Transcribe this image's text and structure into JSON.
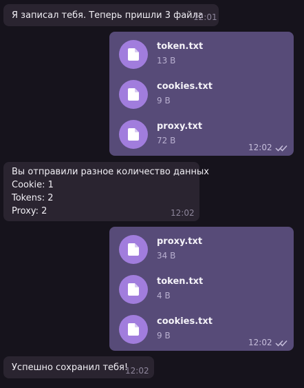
{
  "messages": {
    "m1": {
      "text": "Я записал тебя. Теперь пришли 3 файла",
      "time": "12:01"
    },
    "m2": {
      "files": [
        {
          "name": "token.txt",
          "size": "13 B",
          "icon": "file-icon"
        },
        {
          "name": "cookies.txt",
          "size": "9 B",
          "icon": "file-icon"
        },
        {
          "name": "proxy.txt",
          "size": "72 B",
          "icon": "file-icon"
        }
      ],
      "time": "12:02",
      "status_icon": "double-check-icon"
    },
    "m3": {
      "lines": [
        "Вы отправили разное количество данных",
        "Cookie: 1",
        "Tokens: 2",
        "Proxy: 2"
      ],
      "time": "12:02"
    },
    "m4": {
      "files": [
        {
          "name": "proxy.txt",
          "size": "34 B",
          "icon": "file-icon"
        },
        {
          "name": "token.txt",
          "size": "4 B",
          "icon": "file-icon"
        },
        {
          "name": "cookies.txt",
          "size": "9 B",
          "icon": "file-icon"
        }
      ],
      "time": "12:02",
      "status_icon": "double-check-icon"
    },
    "m5": {
      "text": "Успешно сохранил тебя!",
      "time": "12:02"
    }
  },
  "colors": {
    "background": "#16131c",
    "incoming_bubble": "#2a2430",
    "outgoing_bubble": "#574b78",
    "file_badge": "#a17ddd"
  }
}
